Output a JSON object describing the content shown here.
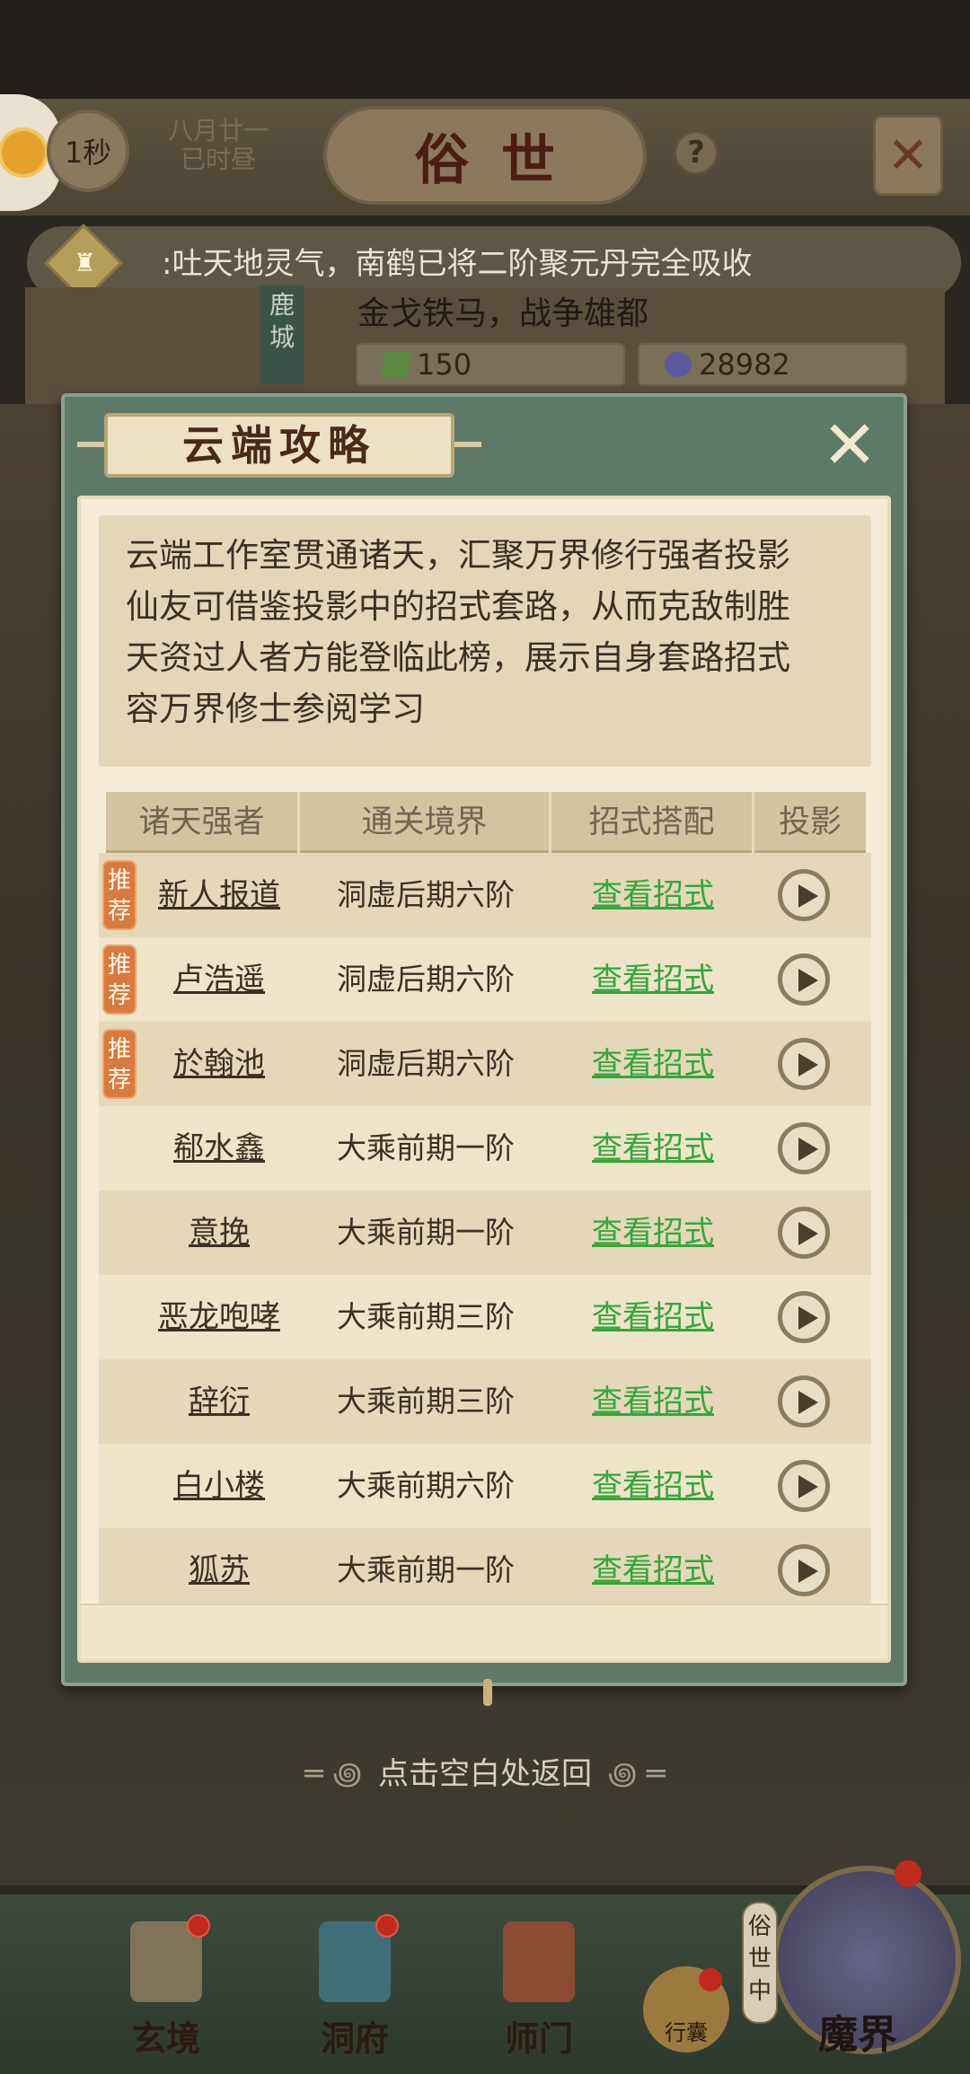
{
  "header": {
    "timer": "1秒",
    "date_line1": "八月廿一",
    "date_line2": "已时昼",
    "world_title": "俗世",
    "help": "?"
  },
  "ticker": {
    "message": ":吐天地灵气，南鹤已将二阶聚元丹完全吸收"
  },
  "city": {
    "tower_text": "鹿城",
    "slogan": "金戈铁马，战争雄都",
    "resource1": "150",
    "resource2": "28982"
  },
  "modal": {
    "title": "云端攻略",
    "description": [
      "云端工作室贯通诸天，汇聚万界修行强者投影",
      "仙友可借鉴投影中的招式套路，从而克敌制胜",
      "天资过人者方能登临此榜，展示自身套路招式",
      "容万界修士参阅学习"
    ],
    "columns": [
      "诸天强者",
      "通关境界",
      "招式搭配",
      "投影"
    ],
    "rows": [
      {
        "recommended": "推荐",
        "name": "新人报道",
        "realm": "洞虚后期六阶",
        "action": "查看招式"
      },
      {
        "recommended": "推荐",
        "name": "卢浩遥",
        "realm": "洞虚后期六阶",
        "action": "查看招式"
      },
      {
        "recommended": "推荐",
        "name": "於翰池",
        "realm": "洞虚后期六阶",
        "action": "查看招式"
      },
      {
        "recommended": "",
        "name": "郗水鑫",
        "realm": "大乘前期一阶",
        "action": "查看招式"
      },
      {
        "recommended": "",
        "name": "意挽",
        "realm": "大乘前期一阶",
        "action": "查看招式"
      },
      {
        "recommended": "",
        "name": "恶龙咆哮",
        "realm": "大乘前期三阶",
        "action": "查看招式"
      },
      {
        "recommended": "",
        "name": "辞衍",
        "realm": "大乘前期三阶",
        "action": "查看招式"
      },
      {
        "recommended": "",
        "name": "白小楼",
        "realm": "大乘前期六阶",
        "action": "查看招式"
      },
      {
        "recommended": "",
        "name": "狐苏",
        "realm": "大乘前期一阶",
        "action": "查看招式"
      }
    ]
  },
  "back_hint": "点击空白处返回",
  "bottom_nav": {
    "items": [
      "玄境",
      "洞府",
      "师门"
    ],
    "bag": "行囊",
    "realm_tag": "俗世中",
    "realm": "魔界"
  },
  "colors": {
    "modal_frame": "#5c7a67",
    "link_green": "#34a63c",
    "recommend_orange": "#d97a3f"
  }
}
